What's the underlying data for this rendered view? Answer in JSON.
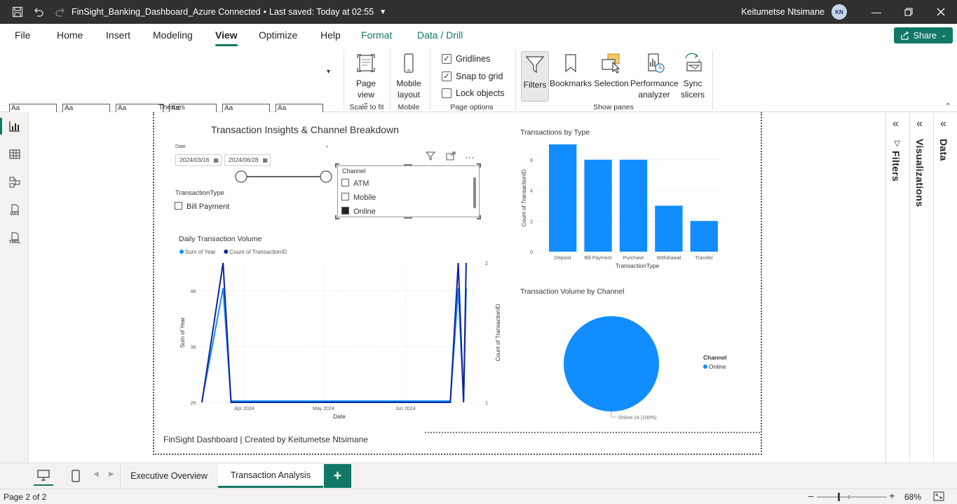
{
  "window": {
    "title": "FinSight_Banking_Dashboard_Azure Connected",
    "saved_status": "Last saved: Today at 02:55",
    "user_name": "Keitumetse Ntsimane",
    "user_initials": "KN"
  },
  "ribbon": {
    "tabs": [
      "File",
      "Home",
      "Insert",
      "Modeling",
      "View",
      "Optimize",
      "Help",
      "Format",
      "Data / Drill"
    ],
    "active_tab": "View",
    "share_label": "Share",
    "themes_label": "Themes",
    "page_view_label": "Page view",
    "page_view_caret": "⌄",
    "scale_to_fit_label": "Scale to fit",
    "mobile_layout_label": "Mobile layout",
    "mobile_group_label": "Mobile",
    "gridlines_label": "Gridlines",
    "snap_to_grid_label": "Snap to grid",
    "lock_objects_label": "Lock objects",
    "page_options_label": "Page options",
    "filters_label": "Filters",
    "bookmarks_label": "Bookmarks",
    "selection_label": "Selection",
    "performance_label": "Performance analyzer",
    "sync_slicers_label": "Sync slicers",
    "show_panes_label": "Show panes"
  },
  "options": {
    "gridlines": true,
    "snap_to_grid": true,
    "lock_objects": false
  },
  "rail_labels": {
    "dax": "DAX",
    "tmdl": "TMDL"
  },
  "report": {
    "title": "Transaction Insights & Channel Breakdown",
    "footer": "FinSight Dashboard | Created by Keitumetse Ntsimane",
    "date_slicer": {
      "label": "Date",
      "start": "2024/03/16",
      "end": "2024/06/28",
      "range": [
        0.0,
        1.0
      ]
    },
    "type_slicer": {
      "label": "TransactionType",
      "items": [
        {
          "label": "Bill Payment",
          "checked": false
        }
      ]
    },
    "channel_slicer": {
      "label": "Channel",
      "items": [
        {
          "label": "ATM",
          "checked": false
        },
        {
          "label": "Mobile",
          "checked": false
        },
        {
          "label": "Online",
          "checked": true
        }
      ]
    }
  },
  "panes": {
    "filters": "Filters",
    "visualizations": "Visualizations",
    "data": "Data"
  },
  "pages": {
    "tabs": [
      "Executive Overview",
      "Transaction Analysis"
    ],
    "active": "Transaction Analysis"
  },
  "status": {
    "page_indicator": "Page 2 of 2",
    "zoom": "68%",
    "zoom_fraction": 0.5
  },
  "colors": {
    "accent": "#117865",
    "bar": "#118dff",
    "line_light": "#118dff",
    "line_dark": "#12239e"
  },
  "chart_data": [
    {
      "type": "bar",
      "title": "Transactions by Type",
      "categories": [
        "Deposit",
        "Bill Payment",
        "Purchase",
        "Withdrawal",
        "Transfer"
      ],
      "values": [
        7,
        6,
        6,
        3,
        2
      ],
      "xlabel": "TransactionType",
      "ylabel": "Count of TransactionID",
      "ylim": [
        0,
        7
      ],
      "yticks": [
        0,
        2,
        4,
        6
      ],
      "grid": true
    },
    {
      "type": "line",
      "title": "Daily Transaction Volume",
      "xlabel": "Date",
      "ylabel": "Sum of Year",
      "y2label": "Count of TransactionID",
      "x_ticks": [
        "Apr 2024",
        "May 2024",
        "Jun 2024"
      ],
      "x_range": [
        "2024-03-16",
        "2024-06-28"
      ],
      "y_ticks": [
        "2K",
        "3K",
        "4K"
      ],
      "ylim": [
        2000,
        4500
      ],
      "y2_ticks": [
        "1",
        "2"
      ],
      "y2lim": [
        1,
        2
      ],
      "legend_position": "top-left",
      "series": [
        {
          "name": "Sum of Year",
          "axis": "left",
          "x": [
            "2024-03-16",
            "2024-03-24",
            "2024-03-27",
            "2024-06-15",
            "2024-06-18",
            "2024-06-21",
            "2024-06-23",
            "2024-06-24"
          ],
          "values": [
            2024,
            4048,
            2024,
            2024,
            2024,
            4048,
            2024,
            4048
          ]
        },
        {
          "name": "Count of TransactionID",
          "axis": "right",
          "x": [
            "2024-03-16",
            "2024-03-24",
            "2024-03-27",
            "2024-06-15",
            "2024-06-18",
            "2024-06-21",
            "2024-06-23",
            "2024-06-24"
          ],
          "values": [
            1,
            2,
            1,
            1,
            1,
            2,
            1,
            2
          ]
        }
      ]
    },
    {
      "type": "pie",
      "title": "Transaction Volume by Channel",
      "legend_title": "Channel",
      "legend_position": "right",
      "slices": [
        {
          "label": "Online",
          "value": 24,
          "percent": 100,
          "data_label": "Online 24 (100%)"
        }
      ]
    }
  ]
}
